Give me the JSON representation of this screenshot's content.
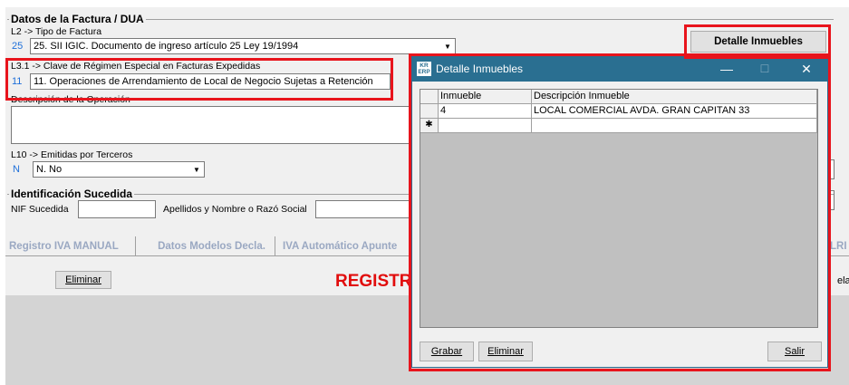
{
  "factura": {
    "section_title": "Datos de la Factura / DUA",
    "tipo_label": "L2 -> Tipo de Factura",
    "tipo_code": "25",
    "tipo_value": "25. SII IGIC. Documento de ingreso artículo 25 Ley 19/1994",
    "regimen_label": "L3.1 -> Clave de Régimen Especial en Facturas Expedidas",
    "regimen_code": "11",
    "regimen_value": "11. Operaciones de Arrendamiento de Local de Negocio Sujetas a Retención",
    "descripcion_label": "Descripción de la Operación",
    "terceros_label": "L10 -> Emitidas por Terceros",
    "terceros_code": "N",
    "terceros_value": "N. No",
    "detalle_button": "Detalle Inmuebles"
  },
  "sucedida": {
    "section_title": "Identificación Sucedida",
    "nif_label": "NIF Sucedida",
    "nombre_label": "Apellidos y Nombre o Razó Social"
  },
  "tabs": [
    "Registro IVA MANUAL",
    "Datos Modelos Decla.",
    "IVA Automático Apunte",
    "LRI"
  ],
  "bottom": {
    "eliminar": "Eliminar",
    "banner": "REGISTR",
    "right_cut": "ela"
  },
  "dialog": {
    "logo_top": "KR",
    "logo_bottom": "ERP",
    "title": "Detalle Inmuebles",
    "minimize": "—",
    "maximize": "☐",
    "close": "✕",
    "columns": [
      "Inmueble",
      "Descripción Inmueble"
    ],
    "rows": [
      {
        "inmueble": "4",
        "descripcion": "LOCAL COMERCIAL AVDA. GRAN CAPITAN 33"
      }
    ],
    "new_row_marker": "✱",
    "grabar": "Grabar",
    "eliminar": "Eliminar",
    "salir": "Salir"
  },
  "colors": {
    "highlight": "#e8141c",
    "title_bar": "#2a6f91",
    "code_blue": "#1e6fd9",
    "tab_text": "#9aa8c2",
    "banner_red": "#e10d0d"
  }
}
